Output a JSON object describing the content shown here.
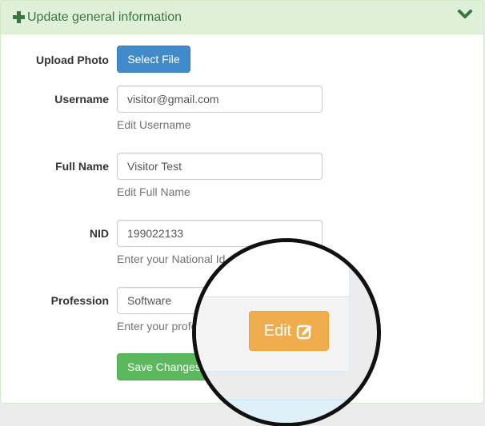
{
  "panel": {
    "title": "Update general information"
  },
  "photo": {
    "label": "Upload Photo",
    "button": "Select File"
  },
  "username": {
    "label": "Username",
    "value": "visitor@gmail.com",
    "help": "Edit Username"
  },
  "fullname": {
    "label": "Full Name",
    "value": "Visitor Test",
    "help": "Edit Full Name"
  },
  "nid": {
    "label": "NID",
    "value": "199022133",
    "help": "Enter your National Id"
  },
  "profession": {
    "label": "Profession",
    "value": "Software",
    "help": "Enter your profession"
  },
  "save": {
    "label": "Save Changes"
  },
  "edit": {
    "label": "Edit"
  },
  "colors": {
    "accent": "#3c763d",
    "primary": "#428bca",
    "success": "#5cb85c",
    "warning": "#f0ad4e"
  },
  "icons": {
    "heading_left": "plus-icon",
    "heading_right": "chevron-down-icon",
    "edit": "edit-square-icon"
  }
}
